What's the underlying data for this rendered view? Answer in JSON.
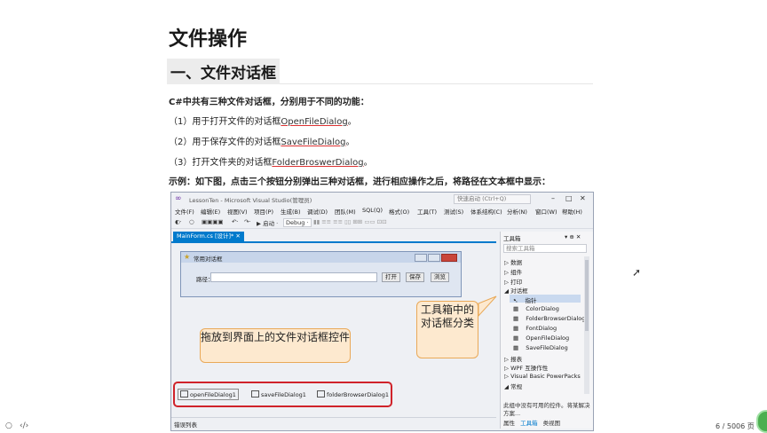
{
  "doc": {
    "title": "文件操作",
    "section": "一、文件对话框",
    "intro": "C#中共有三种文件对话框，分别用于不同的功能：",
    "item1_prefix": "（1）用于打开文件的对话框",
    "item1_link": "OpenFileDialog",
    "item1_suffix": "。",
    "item2_prefix": "（2）用于保存文件的对话框",
    "item2_link": "SaveFileDialog",
    "item2_suffix": "。",
    "item3_prefix": "（3）打开文件夹的对话框",
    "item3_link": "FolderBroswerDialog",
    "item3_suffix": "。",
    "example": "示例：如下图，点击三个按钮分别弹出三种对话框，进行相应操作之后，将路径在文本框中显示："
  },
  "vs": {
    "window_title": "LessonTen - Microsoft Visual Studio(管理员)",
    "quick_search": "快速启动 (Ctrl+Q)",
    "menu": [
      "文件(F)",
      "编辑(E)",
      "视图(V)",
      "项目(P)",
      "生成(B)",
      "调试(D)",
      "团队(M)",
      "SQL(Q)",
      "格式(O)",
      "工具(T)",
      "测试(S)",
      "体系结构(C)",
      "分析(N)",
      "窗口(W)",
      "帮助(H)"
    ],
    "toolbar_debug": "▶ 启动 ·",
    "toolbar_config": "Debug ·",
    "tab_label": "MainForm.cs [设计]*",
    "form_title": "常用对话框",
    "path_label": "路径：",
    "btn_open": "打开",
    "btn_save": "保存",
    "btn_browse": "浏览",
    "callout_drag": "拖放到界面上的文件对话框控件",
    "callout_toolbox": "工具箱中的对话框分类",
    "components": [
      "openFileDialog1",
      "saveFileDialog1",
      "folderBrowserDialog1"
    ],
    "status": "错误列表",
    "toolbox": {
      "title": "工具箱",
      "search": "搜索工具箱",
      "groups": [
        "▷ 数据",
        "▷ 组件",
        "▷ 打印",
        "◢ 对话框"
      ],
      "pointer": "指针",
      "dialogs": [
        "ColorDialog",
        "FolderBrowserDialog",
        "FontDialog",
        "OpenFileDialog",
        "SaveFileDialog"
      ],
      "groups2": [
        "▷ 报表",
        "▷ WPF 互操作性",
        "▷ Visual Basic PowerPacks",
        "◢ 常规"
      ],
      "footer": "此组中没有可用的控件。将某解决方案...",
      "tabs": [
        "属性",
        "工具箱",
        "类视图"
      ]
    }
  },
  "page_number": "6 / 5006 页"
}
